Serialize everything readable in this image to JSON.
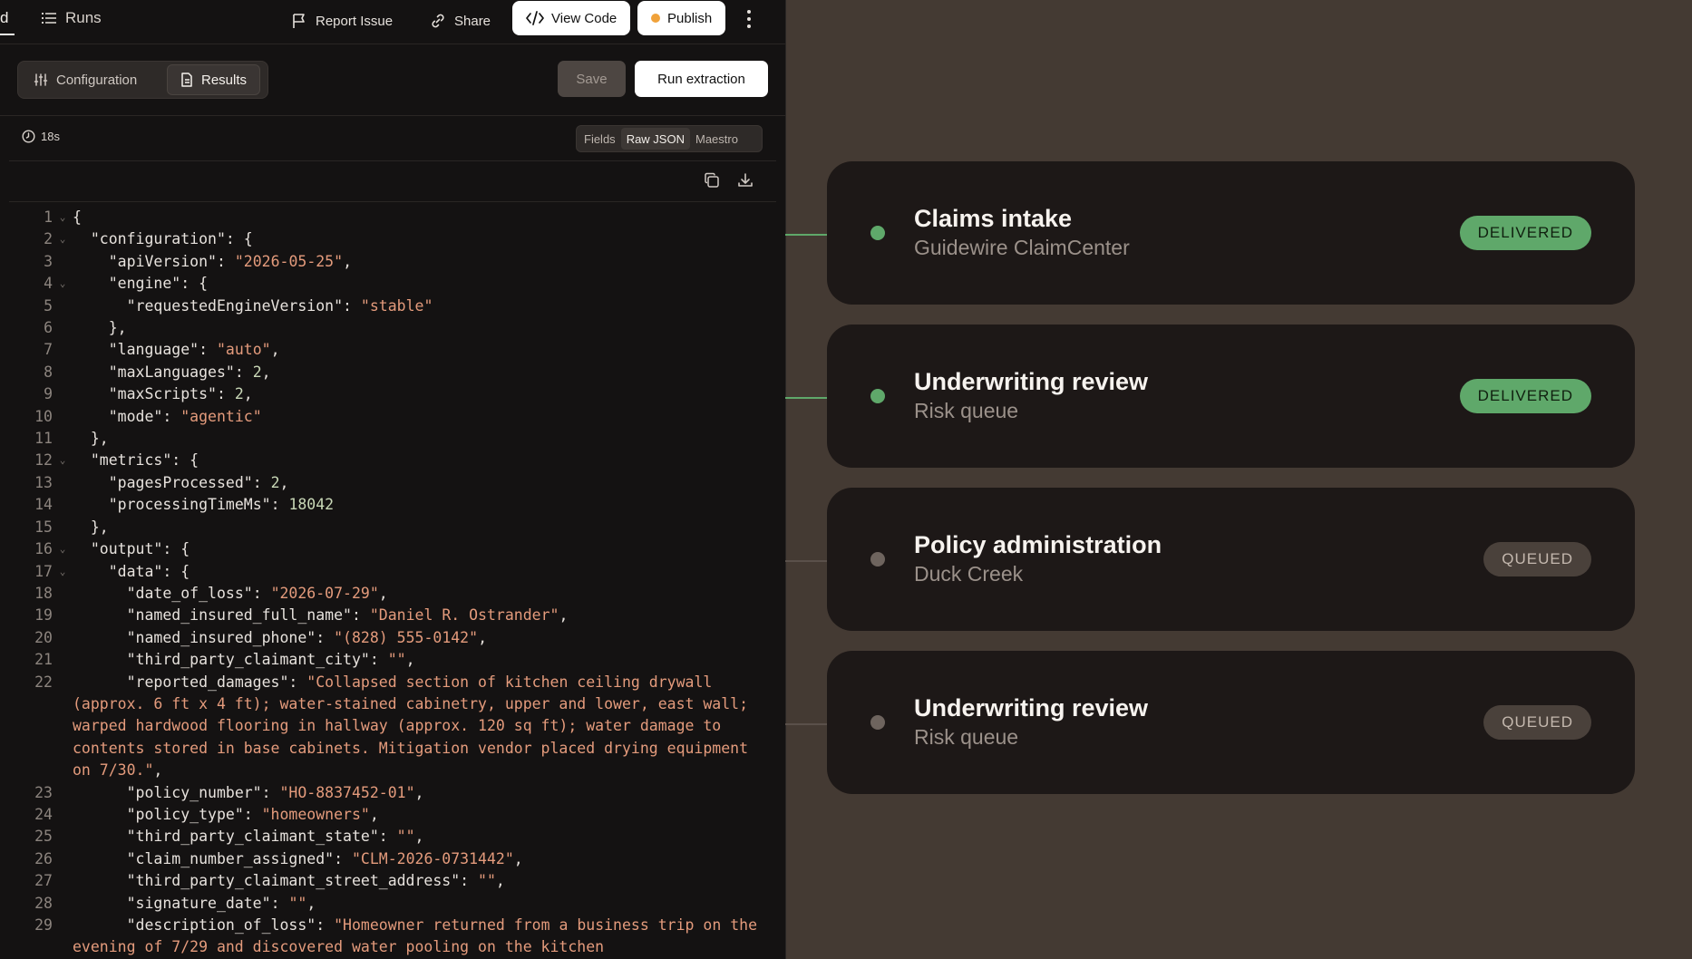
{
  "topbar": {
    "tab_partial": "d",
    "runs_label": "Runs",
    "report_issue": "Report Issue",
    "share": "Share",
    "view_code": "View Code",
    "publish": "Publish"
  },
  "toolbar": {
    "configuration_tab": "Configuration",
    "results_tab": "Results",
    "save": "Save",
    "run_extraction": "Run extraction"
  },
  "info": {
    "elapsed": "18s",
    "views": [
      "Fields",
      "Raw JSON",
      "Maestro"
    ],
    "active_view": "Raw JSON"
  },
  "code_lines": [
    {
      "n": "1",
      "f": true,
      "t": "{"
    },
    {
      "n": "2",
      "f": true,
      "t": "  \"configuration\": {"
    },
    {
      "n": "3",
      "f": false,
      "t": "    \"apiVersion\": \"2026-05-25\","
    },
    {
      "n": "4",
      "f": true,
      "t": "    \"engine\": {"
    },
    {
      "n": "5",
      "f": false,
      "t": "      \"requestedEngineVersion\": \"stable\""
    },
    {
      "n": "6",
      "f": false,
      "t": "    },"
    },
    {
      "n": "7",
      "f": false,
      "t": "    \"language\": \"auto\","
    },
    {
      "n": "8",
      "f": false,
      "t": "    \"maxLanguages\": 2,"
    },
    {
      "n": "9",
      "f": false,
      "t": "    \"maxScripts\": 2,"
    },
    {
      "n": "10",
      "f": false,
      "t": "    \"mode\": \"agentic\""
    },
    {
      "n": "11",
      "f": false,
      "t": "  },"
    },
    {
      "n": "12",
      "f": true,
      "t": "  \"metrics\": {"
    },
    {
      "n": "13",
      "f": false,
      "t": "    \"pagesProcessed\": 2,"
    },
    {
      "n": "14",
      "f": false,
      "t": "    \"processingTimeMs\": 18042"
    },
    {
      "n": "15",
      "f": false,
      "t": "  },"
    },
    {
      "n": "16",
      "f": true,
      "t": "  \"output\": {"
    },
    {
      "n": "17",
      "f": true,
      "t": "    \"data\": {"
    },
    {
      "n": "18",
      "f": false,
      "t": "      \"date_of_loss\": \"2026-07-29\","
    },
    {
      "n": "19",
      "f": false,
      "t": "      \"named_insured_full_name\": \"Daniel R. Ostrander\","
    },
    {
      "n": "20",
      "f": false,
      "t": "      \"named_insured_phone\": \"(828) 555-0142\","
    },
    {
      "n": "21",
      "f": false,
      "t": "      \"third_party_claimant_city\": \"\","
    },
    {
      "n": "22",
      "f": false,
      "t": "      \"reported_damages\": \"Collapsed section of kitchen ceiling drywall (approx. 6 ft x 4 ft); water-stained cabinetry, upper and lower, east wall; warped hardwood flooring in hallway (approx. 120 sq ft); water damage to contents stored in base cabinets. Mitigation vendor placed drying equipment on 7/30.\","
    },
    {
      "n": "23",
      "f": false,
      "t": "      \"policy_number\": \"HO-8837452-01\","
    },
    {
      "n": "24",
      "f": false,
      "t": "      \"policy_type\": \"homeowners\","
    },
    {
      "n": "25",
      "f": false,
      "t": "      \"third_party_claimant_state\": \"\","
    },
    {
      "n": "26",
      "f": false,
      "t": "      \"claim_number_assigned\": \"CLM-2026-0731442\","
    },
    {
      "n": "27",
      "f": false,
      "t": "      \"third_party_claimant_street_address\": \"\","
    },
    {
      "n": "28",
      "f": false,
      "t": "      \"signature_date\": \"\","
    },
    {
      "n": "29",
      "f": false,
      "t": "      \"description_of_loss\": \"Homeowner returned from a business trip on the evening of 7/29 and discovered water pooling on the kitchen"
    }
  ],
  "destinations": [
    {
      "title": "Claims intake",
      "subtitle": "Guidewire ClaimCenter",
      "status": "DELIVERED",
      "state": "delivered"
    },
    {
      "title": "Underwriting review",
      "subtitle": "Risk queue",
      "status": "DELIVERED",
      "state": "delivered"
    },
    {
      "title": "Policy administration",
      "subtitle": "Duck Creek",
      "status": "QUEUED",
      "state": "queued"
    },
    {
      "title": "Underwriting review",
      "subtitle": "Risk queue",
      "status": "QUEUED",
      "state": "queued"
    }
  ],
  "colors": {
    "delivered_dot": "#5fa86a",
    "queued_dot": "#6e645e",
    "delivered_line": "#5fa86a",
    "queued_line": "#5a504a",
    "publish_dot": "#f0a23a",
    "string": "#e49b7c",
    "number": "#c9d8b7"
  }
}
